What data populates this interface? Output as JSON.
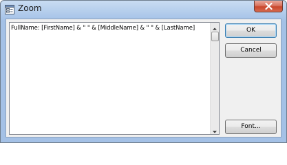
{
  "window": {
    "title": "Zoom",
    "icon": "form-window-icon",
    "close_icon": "close-x-icon"
  },
  "editor": {
    "value": "FullName: [FirstName] & \" \" & [MiddleName] & \" \" & [LastName]"
  },
  "buttons": {
    "ok_label": "OK",
    "cancel_label": "Cancel",
    "font_label": "Font..."
  },
  "colors": {
    "titlebar": "#bcd3ee",
    "close_button": "#c9472c",
    "default_button_border": "#3c7fb1"
  }
}
